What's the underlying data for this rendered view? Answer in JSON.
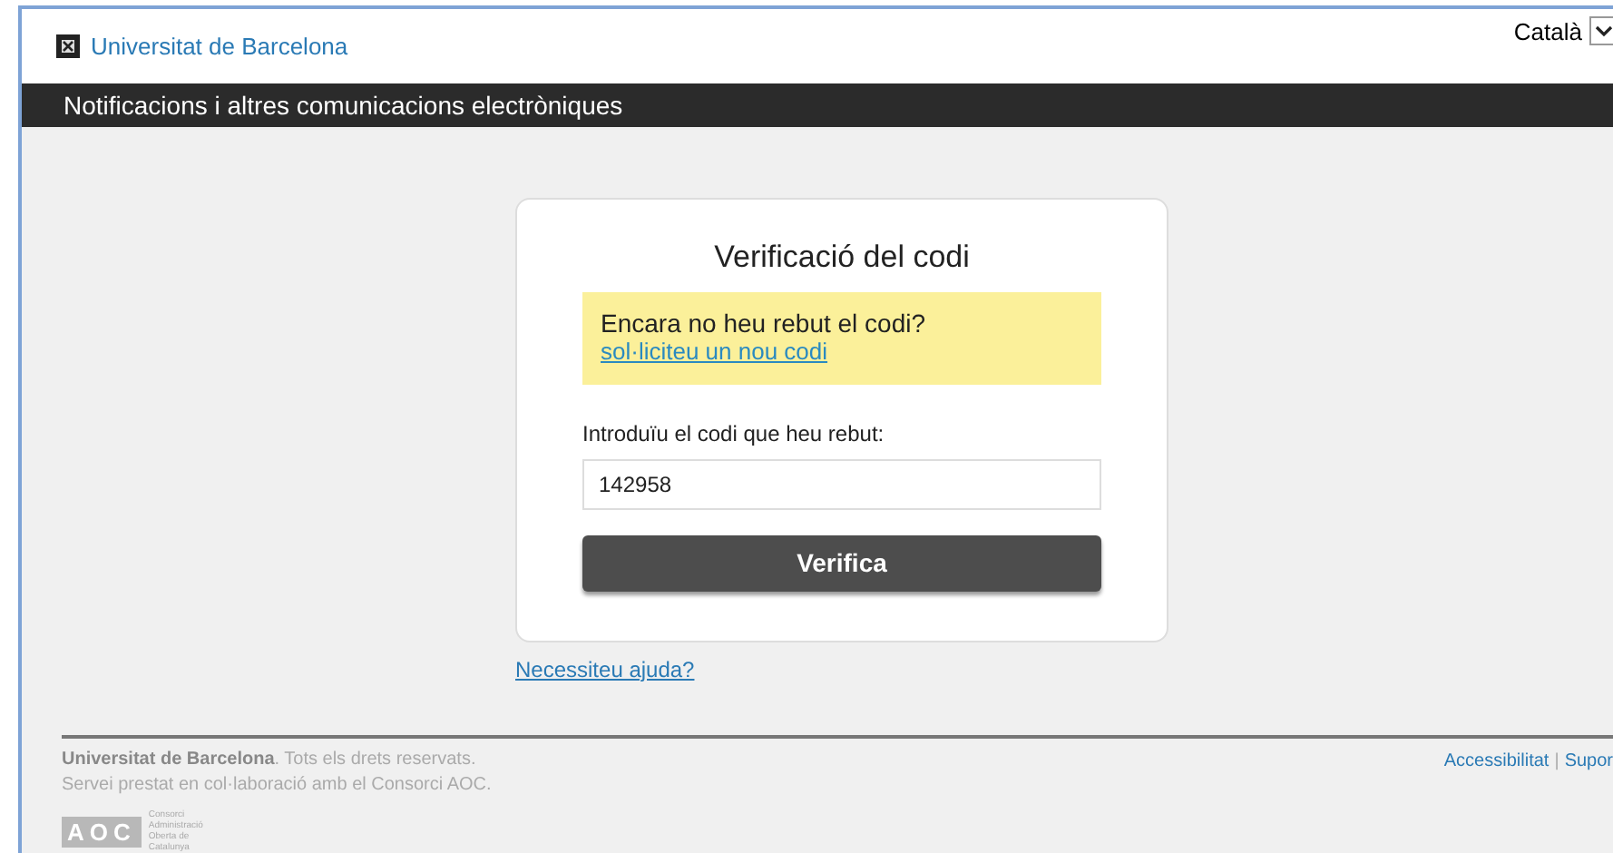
{
  "header": {
    "site_name": "Universitat de Barcelona",
    "language": "Català"
  },
  "title_bar": {
    "title": "Notificacions i altres comunicacions electròniques"
  },
  "card": {
    "title": "Verificació del codi",
    "notice": {
      "text": "Encara no heu rebut el codi?",
      "link": "sol·liciteu un nou codi"
    },
    "field_label": "Introduïu el codi que heu rebut:",
    "code_value": "142958",
    "submit": "Verifica"
  },
  "help_link": "Necessiteu ajuda?",
  "footer": {
    "copyright": "**Universitat de Barcelona**. Tots els drets reservats.",
    "service": "Servei prestat en col·laboració amb el Consorci AOC.",
    "logo": {
      "letters": "AOC",
      "caption": "Consorci Administració Oberta de Catalunya"
    },
    "links": [
      "Accessibilitat",
      "Supor"
    ],
    "separator": "|"
  }
}
